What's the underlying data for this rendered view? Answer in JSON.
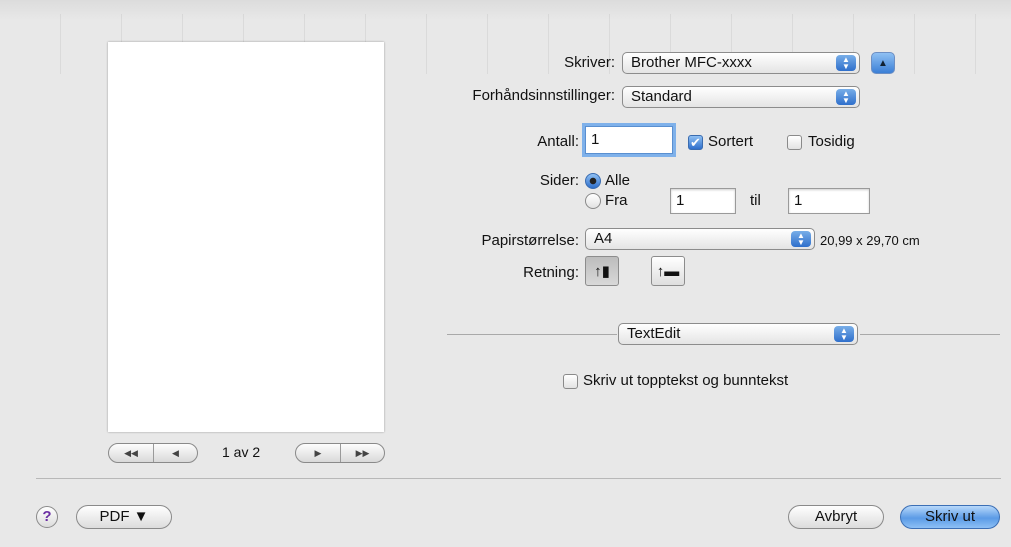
{
  "printer": {
    "label": "Skriver:",
    "value": "Brother MFC-xxxx"
  },
  "presets": {
    "label": "Forhåndsinnstillinger:",
    "value": "Standard"
  },
  "copies": {
    "label": "Antall:",
    "value": "1",
    "collated_label": "Sortert",
    "collated": true,
    "two_sided_label": "Tosidig",
    "two_sided": false
  },
  "pages": {
    "label": "Sider:",
    "all_label": "Alle",
    "from_label": "Fra",
    "from_value": "1",
    "to_label": "til",
    "to_value": "1",
    "selected": "all"
  },
  "paper_size": {
    "label": "Papirstørrelse:",
    "value": "A4",
    "dimensions": "20,99 x 29,70 cm"
  },
  "orientation": {
    "label": "Retning:",
    "selected": "portrait",
    "portrait_icon": "portrait-orientation-icon",
    "landscape_icon": "landscape-orientation-icon"
  },
  "app_section": {
    "value": "TextEdit",
    "header_footer_label": "Skriv ut topptekst og bunntekst",
    "header_footer": false
  },
  "preview": {
    "page_indicator": "1 av 2"
  },
  "footer": {
    "help_label": "?",
    "pdf_label": "PDF ▼",
    "cancel_label": "Avbryt",
    "print_label": "Skriv ut"
  },
  "colors": {
    "accent": "#3b7fd6",
    "help_icon": "#6b2fa3"
  }
}
